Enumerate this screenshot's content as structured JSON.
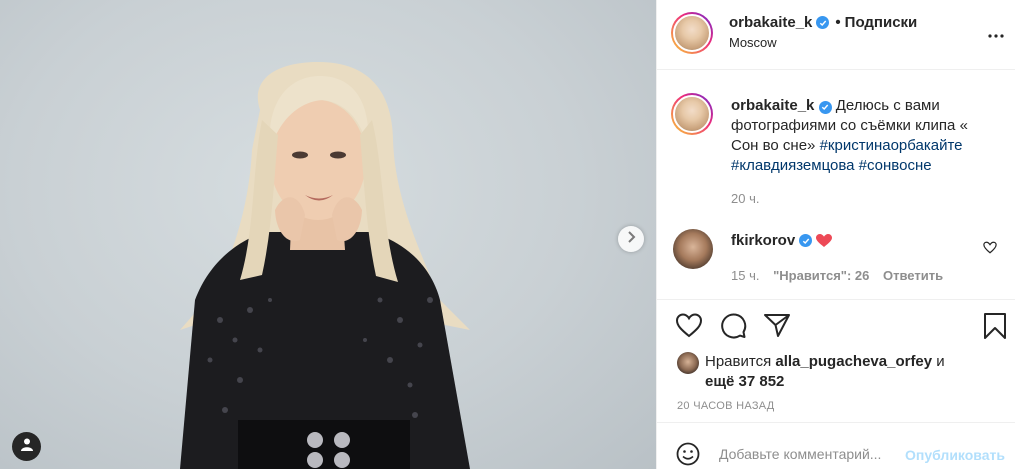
{
  "post": {
    "author": "orbakaite_k",
    "follow_label": "Подписки",
    "location": "Moscow"
  },
  "caption": {
    "user": "orbakaite_k",
    "text": "Делюсь с вами фотографиями со съёмки клипа « Сон во сне»",
    "hashtags": [
      "#кристинаорбакайте",
      "#клавдияземцова",
      "#сонвосне"
    ],
    "age": "20 ч."
  },
  "comment": {
    "user": "fkirkorov",
    "emoji": "❤️",
    "age": "15 ч.",
    "likes_label": "\"Нравится\": 26",
    "reply_label": "Ответить"
  },
  "likes": {
    "prefix": "Нравится",
    "user": "alla_pugacheva_orfey",
    "joiner": "и",
    "rest": "ещё 37 852"
  },
  "timestamp": "20 ЧАСОВ НАЗАД",
  "add_comment": {
    "placeholder": "Добавьте комментарий...",
    "post_label": "Опубликовать"
  },
  "icons": {
    "heart": "heart-icon",
    "comment": "comment-icon",
    "share": "share-icon",
    "save": "bookmark-icon",
    "more": "more-icon",
    "emoji": "emoji-icon",
    "next": "chevron-right-icon",
    "tag": "user-tag-icon"
  },
  "colors": {
    "verified": "#3897f0",
    "hashtag": "#00376b",
    "heart": "#ed4956",
    "post_disabled": "#b2dffc"
  }
}
